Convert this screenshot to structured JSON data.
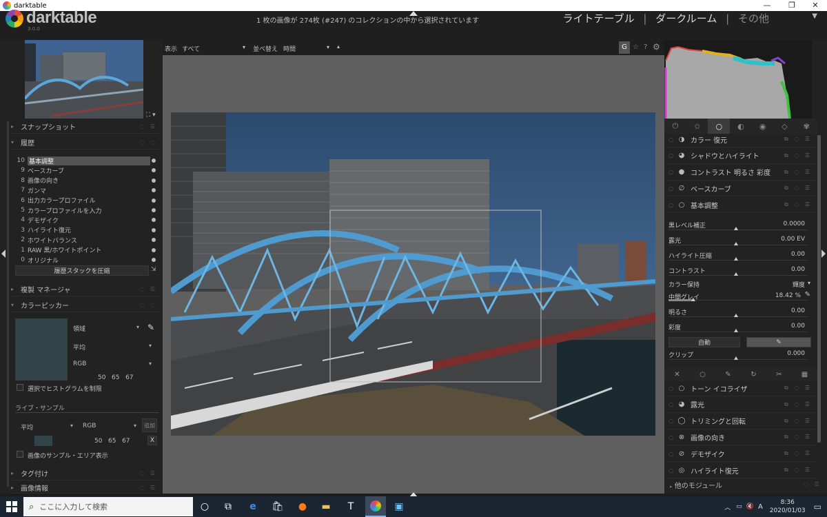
{
  "window": {
    "title": "darktable",
    "minimize": "—",
    "maximize": "❐",
    "close": "✕"
  },
  "header": {
    "logo": "darktable",
    "version": "3.0.0",
    "status": "1 枚の画像が 274枚 (#247) のコレクションの中から選択されています",
    "views": {
      "lighttable": "ライトテーブル",
      "darkroom": "ダークルーム",
      "other": "その他",
      "sep": "|"
    }
  },
  "toolbar": {
    "display_label": "表示",
    "display_value": "すべて",
    "sort_label": "並べ替え",
    "sort_value": "時間",
    "g_button": "G",
    "star": "☆",
    "help": "?",
    "settings": "⚙"
  },
  "left": {
    "snapshots": "スナップショット",
    "history": "履歴",
    "history_items": [
      {
        "num": "10",
        "label": "基本調整"
      },
      {
        "num": "9",
        "label": "ベースカーブ"
      },
      {
        "num": "8",
        "label": "画像の向き"
      },
      {
        "num": "7",
        "label": "ガンマ"
      },
      {
        "num": "6",
        "label": "出力カラープロファイル"
      },
      {
        "num": "5",
        "label": "カラープロファイルを入力"
      },
      {
        "num": "4",
        "label": "デモザイク"
      },
      {
        "num": "3",
        "label": "ハイライト復元"
      },
      {
        "num": "2",
        "label": "ホワイトバランス"
      },
      {
        "num": "1",
        "label": "RAW 黒/ホワイトポイント"
      },
      {
        "num": "0",
        "label": "オリジナル"
      }
    ],
    "compress_button": "履歴スタックを圧縮",
    "copy_manager": "複製 マネージャ",
    "color_picker": "カラーピッカー",
    "picker_mode": "領域",
    "picker_stat": "平均",
    "picker_space": "RGB",
    "picker_values": "50   65   67",
    "restrict_histogram": "選択でヒストグラムを制限",
    "live_samples": "ライブ・サンプル",
    "live_stat": "平均",
    "live_space": "RGB",
    "live_add": "追加",
    "live_values": "50   65   67",
    "live_remove": "X",
    "show_area": "画像のサンプル・エリア表示",
    "tagging": "タグ付け",
    "image_info": "画像情報",
    "swatch_color": "#33434a"
  },
  "right": {
    "tabs": [
      "⏻",
      "✩",
      "○",
      "◐",
      "◉",
      "◇",
      "✾"
    ],
    "modules_top": [
      {
        "icon": "◑",
        "label": "カラー 復元"
      },
      {
        "icon": "◕",
        "label": "シャドウとハイライト"
      },
      {
        "icon": "●",
        "label": "コントラスト 明るさ 彩度"
      },
      {
        "icon": "∅",
        "label": "ベースカーブ"
      },
      {
        "icon": "○",
        "label": "基本調整"
      }
    ],
    "sliders": [
      {
        "name": "黒レベル補正",
        "value": "0.0000"
      },
      {
        "name": "露光",
        "value": "0.00 EV"
      },
      {
        "name": "ハイライト圧縮",
        "value": "0.00"
      },
      {
        "name": "コントラスト",
        "value": "0.00"
      }
    ],
    "color_preserve_label": "カラー保持",
    "color_preserve_value": "輝度",
    "mid_gray_label": "中間グレイ",
    "mid_gray_value": "18.42 %",
    "sliders2": [
      {
        "name": "明るさ",
        "value": "0.00"
      },
      {
        "name": "彩度",
        "value": "0.00"
      }
    ],
    "auto_button": "自動",
    "clip_label": "クリップ",
    "clip_value": "0.000",
    "tool_icons": [
      "✕",
      "○",
      "✎",
      "↻",
      "✂",
      "▦"
    ],
    "modules_bottom": [
      {
        "icon": "○",
        "label": "トーン イコライザ"
      },
      {
        "icon": "◕",
        "label": "露光"
      },
      {
        "icon": "◯",
        "label": "トリミングと回転"
      },
      {
        "icon": "⊗",
        "label": "画像の向き"
      },
      {
        "icon": "⊘",
        "label": "デモザイク"
      },
      {
        "icon": "◎",
        "label": "ハイライト復元"
      }
    ],
    "more_modules": "他のモジュール"
  },
  "taskbar": {
    "search_placeholder": "ここに入力して検索",
    "time": "8:36",
    "date": "2020/01/03",
    "ime": "A"
  }
}
